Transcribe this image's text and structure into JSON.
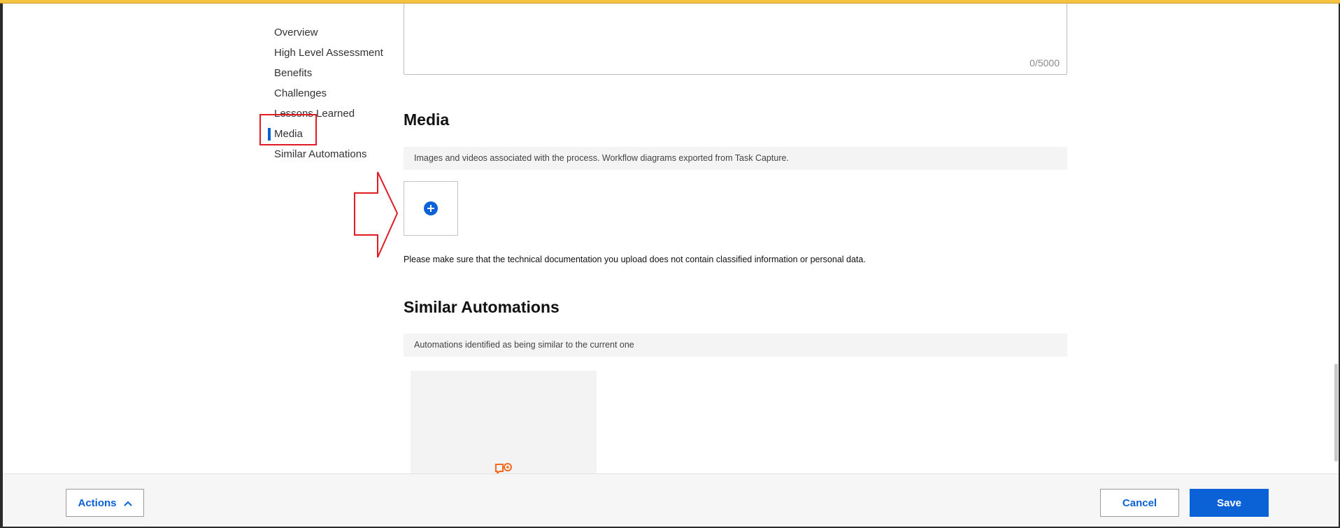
{
  "nav": {
    "items": [
      {
        "label": "Overview",
        "active": false
      },
      {
        "label": "High Level Assessment",
        "active": false
      },
      {
        "label": "Benefits",
        "active": false
      },
      {
        "label": "Challenges",
        "active": false
      },
      {
        "label": "Lessons Learned",
        "active": false
      },
      {
        "label": "Media",
        "active": true
      },
      {
        "label": "Similar Automations",
        "active": false
      }
    ]
  },
  "previous_field": {
    "char_count": "0/5000"
  },
  "media": {
    "title": "Media",
    "description": "Images and videos associated with the process. Workflow diagrams exported from Task Capture.",
    "add_icon": "plus-circle-icon",
    "note": "Please make sure that the technical documentation you upload does not contain classified information or personal data."
  },
  "similar_automations": {
    "title": "Similar Automations",
    "description": "Automations identified as being similar to the current one",
    "card_icon": "robot-gear-icon"
  },
  "footer": {
    "actions_label": "Actions",
    "actions_icon": "chevron-up-icon",
    "cancel_label": "Cancel",
    "save_label": "Save"
  },
  "colors": {
    "accent": "#0b62d6",
    "annotation": "#e01b24",
    "robot_icon": "#f26b21",
    "top_strip": "#f5c542"
  }
}
